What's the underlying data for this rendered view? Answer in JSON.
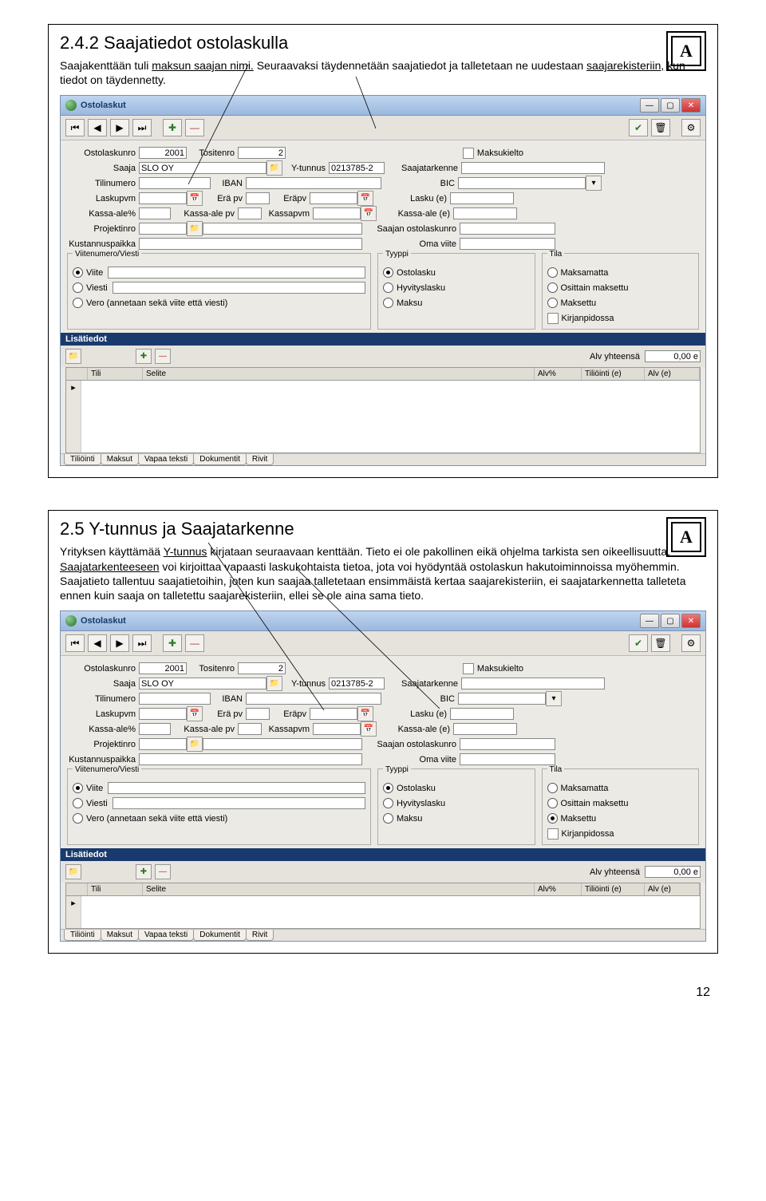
{
  "page_number": "12",
  "section1": {
    "heading": "2.4.2 Saajatiedot ostolaskulla",
    "intro_a": "Saajakenttään tuli ",
    "intro_b": "maksun saajan nimi.",
    "intro_c": " Seuraavaksi täydennetään saajatiedot ja talletetaan ne uudestaan ",
    "intro_d": "saajarekisteriin,",
    "intro_e": " kun tiedot on täydennetty.",
    "badge": "A"
  },
  "section2": {
    "heading": "2.5 Y-tunnus ja Saajatarkenne",
    "intro_a": "Yrityksen käyttämää ",
    "intro_b": "Y-tunnus",
    "intro_c": " kirjataan seuraavaan kenttään. Tieto ei ole pakollinen eikä ohjelma tarkista sen oikeellisuutta. ",
    "intro_d": "Saajatarkenteeseen",
    "intro_e": " voi kirjoittaa vapaasti laskukohtaista tietoa, jota voi hyödyntää ostolaskun hakutoiminnoissa myöhemmin.",
    "intro_f": "Saajatieto tallentuu saajatietoihin, joten kun saajaa talletetaan ensimmäistä kertaa saajarekisteriin, ei saajatarkennetta talleteta ennen kuin saaja on talletettu saajarekisteriin, ellei se ole aina sama tieto.",
    "badge": "A"
  },
  "window": {
    "title": "Ostolaskut",
    "labels": {
      "ostolaskunro": "Ostolaskunro",
      "tositenro": "Tositenro",
      "maksukielto": "Maksukielto",
      "saaja": "Saaja",
      "ytunnus": "Y-tunnus",
      "saajatarkenne": "Saajatarkenne",
      "tilinumero": "Tilinumero",
      "iban": "IBAN",
      "bic": "BIC",
      "laskupvm": "Laskupvm",
      "erapv": "Erä pv",
      "erapv2": "Eräpv",
      "lasku_e": "Lasku (e)",
      "kassa_ale_pct": "Kassa-ale%",
      "kassa_ale_pv": "Kassa-ale pv",
      "kassapvm": "Kassapvm",
      "kassa_ale_e": "Kassa-ale (e)",
      "projektinro": "Projektinro",
      "saajan_ostolaskunro": "Saajan ostolaskunro",
      "kustannuspaikka": "Kustannuspaikka",
      "oma_viite": "Oma viite",
      "viitenumero_viesti": "Viitenumero/Viesti",
      "viite": "Viite",
      "viesti": "Viesti",
      "vero": "Vero (annetaan sekä viite että viesti)",
      "tyyppi": "Tyyppi",
      "ostolasku": "Ostolasku",
      "hyvityslasku": "Hyvityslasku",
      "maksu": "Maksu",
      "tila": "Tila",
      "maksamatta": "Maksamatta",
      "osittain": "Osittain maksettu",
      "maksettu": "Maksettu",
      "kirjanpidossa": "Kirjanpidossa",
      "lisatiedot": "Lisätiedot",
      "alv_yhteensa": "Alv yhteensä",
      "tili": "Tili",
      "selite": "Selite",
      "alv_pct": "Alv%",
      "tiliointi_e": "Tiliöinti (e)",
      "alv_e": "Alv (e)"
    },
    "values": {
      "ostolaskunro": "2001",
      "tositenro": "2",
      "saaja": "SLO OY",
      "ytunnus": "0213785-2",
      "alv_total": "0,00 e"
    },
    "tabs": [
      "Tiliöinti",
      "Maksut",
      "Vapaa teksti",
      "Dokumentit",
      "Rivit"
    ]
  }
}
